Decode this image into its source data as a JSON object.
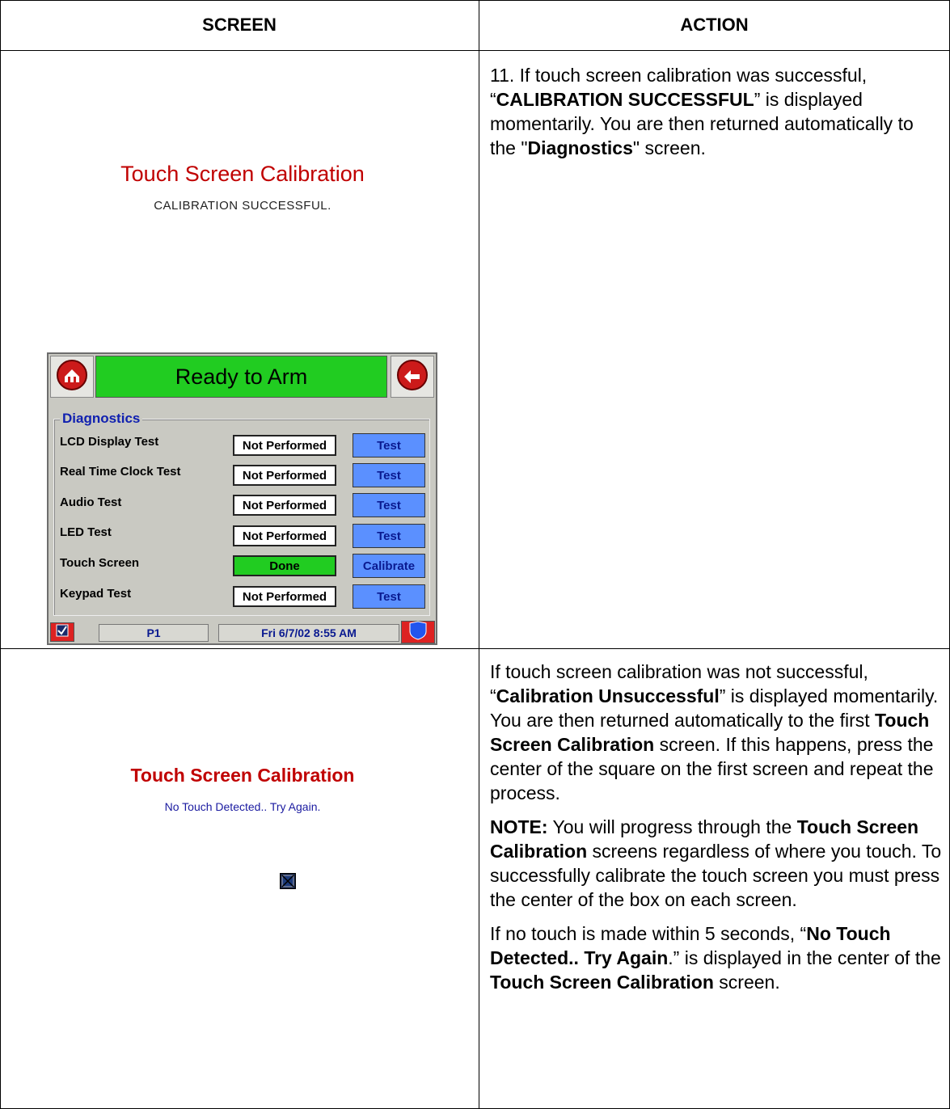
{
  "table": {
    "col_screen": "SCREEN",
    "col_action": "ACTION"
  },
  "row1": {
    "screen": {
      "title": "Touch Screen Calibration",
      "message": "CALIBRATION SUCCESSFUL."
    },
    "device": {
      "status": "Ready to Arm",
      "group_label": "Diagnostics",
      "rows": [
        {
          "label": "LCD Display Test",
          "state": "Not Performed",
          "button": "Test"
        },
        {
          "label": "Real Time Clock Test",
          "state": "Not Performed",
          "button": "Test"
        },
        {
          "label": "Audio Test",
          "state": "Not Performed",
          "button": "Test"
        },
        {
          "label": "LED Test",
          "state": "Not Performed",
          "button": "Test"
        },
        {
          "label": "Touch Screen",
          "state": "Done",
          "button": "Calibrate"
        },
        {
          "label": "Keypad Test",
          "state": "Not Performed",
          "button": "Test"
        }
      ],
      "page": "P1",
      "datetime": "Fri 6/7/02  8:55 AM"
    },
    "action": {
      "p1_a": "11.  If touch screen calibration was successful, “",
      "p1_b": "CALIBRATION SUCCESSFUL",
      "p1_c": "” is displayed momentarily. You are then returned automatically to the \"",
      "p1_d": "Diagnostics",
      "p1_e": "\" screen."
    }
  },
  "row2": {
    "screen": {
      "title": "Touch Screen Calibration",
      "message": "No Touch Detected.. Try Again."
    },
    "action": {
      "p1_a": "If touch screen calibration was not successful, “",
      "p1_b": "Calibration Unsuccessful",
      "p1_c": "” is displayed momentarily. You are then returned automatically to the first ",
      "p1_d": "Touch Screen Calibration",
      "p1_e": " screen.  If this happens, press the center of the square on the first screen and repeat the process.",
      "p2_a": "NOTE:",
      "p2_b": " You will progress through the ",
      "p2_c": "Touch Screen Calibration",
      "p2_d": " screens regardless of where you touch. To successfully calibrate the touch screen you must press the center of the box on each screen.",
      "p3_a": "If no touch is made within 5 seconds, “",
      "p3_b": "No Touch Detected.. Try Again",
      "p3_c": ".” is displayed in the center of the ",
      "p3_d": "Touch Screen Calibration",
      "p3_e": " screen."
    }
  }
}
